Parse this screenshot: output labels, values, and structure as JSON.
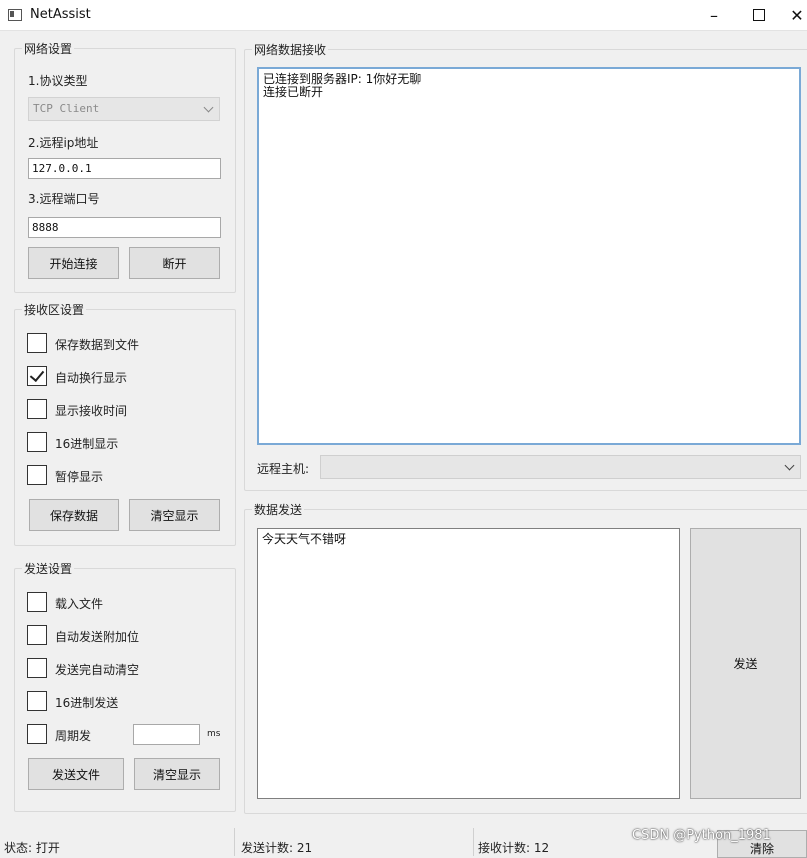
{
  "window": {
    "title": "NetAssist"
  },
  "network_settings": {
    "group_title": "网络设置",
    "protocol_label": "1.协议类型",
    "protocol_value": "TCP Client",
    "remote_ip_label": "2.远程ip地址",
    "remote_ip_value": "127.0.0.1",
    "remote_port_label": "3.远程端口号",
    "remote_port_value": "8888",
    "connect_button": "开始连接",
    "disconnect_button": "断开"
  },
  "receive_settings": {
    "group_title": "接收区设置",
    "options": [
      {
        "label": "保存数据到文件",
        "checked": false
      },
      {
        "label": "自动换行显示",
        "checked": true
      },
      {
        "label": "显示接收时间",
        "checked": false
      },
      {
        "label": "16进制显示",
        "checked": false
      },
      {
        "label": "暂停显示",
        "checked": false
      }
    ],
    "save_button": "保存数据",
    "clear_button": "清空显示"
  },
  "send_settings": {
    "group_title": "发送设置",
    "options": [
      {
        "label": "载入文件",
        "checked": false
      },
      {
        "label": "自动发送附加位",
        "checked": false
      },
      {
        "label": "发送完自动清空",
        "checked": false
      },
      {
        "label": "16进制发送",
        "checked": false
      },
      {
        "label": "周期发",
        "checked": false
      }
    ],
    "period_value": "",
    "period_unit": "ms",
    "send_file_button": "发送文件",
    "clear_button": "清空显示"
  },
  "receive_panel": {
    "group_title": "网络数据接收",
    "text": "已连接到服务器IP: 1你好无聊\n连接已断开",
    "remote_host_label": "远程主机:",
    "remote_host_value": ""
  },
  "send_panel": {
    "group_title": "数据发送",
    "text": "今天天气不错呀",
    "send_button": "发送"
  },
  "status_bar": {
    "state": "状态: 打开",
    "sent_count": "发送计数: 21",
    "recv_count": "接收计数: 12",
    "clear_button": "清除",
    "watermark": "CSDN @Python_1981"
  },
  "colors": {
    "focus_border": "#7aa9d6",
    "window_bg": "#f0f0f0"
  }
}
